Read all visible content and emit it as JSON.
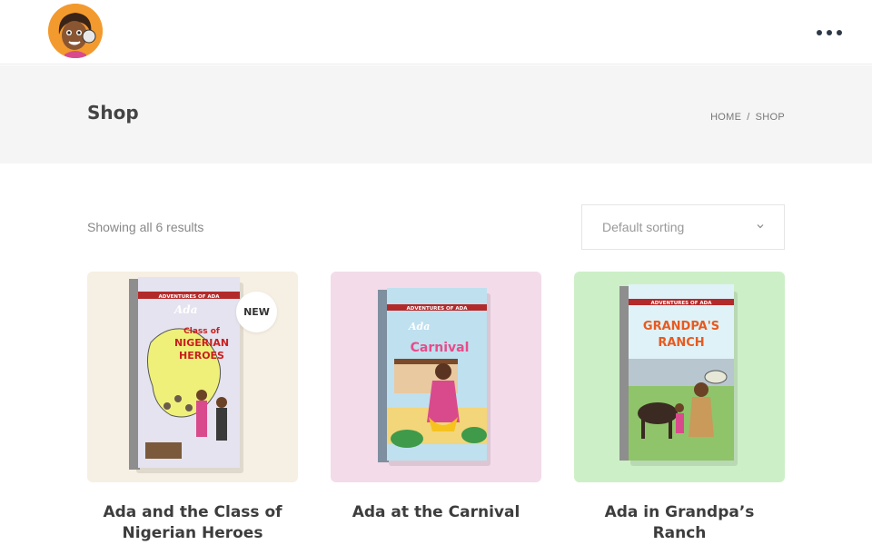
{
  "header": {
    "logo_icon": "avatar-logo-icon",
    "menu_icon": "more-dots-icon"
  },
  "title_band": {
    "title": "Shop",
    "breadcrumb": {
      "home": "HOME",
      "separator": "/",
      "current": "SHOP"
    }
  },
  "toolbar": {
    "results_text": "Showing all 6 results",
    "sort_selected": "Default sorting"
  },
  "colors": {
    "card1_bg": "#f6efe3",
    "card2_bg": "#f3dbe9",
    "card3_bg": "#cdefc7",
    "heading": "#3d3d3d",
    "band_bg": "#f5f5f5"
  },
  "products": [
    {
      "title": "Ada and the Class of Nigerian Heroes",
      "badge": "NEW",
      "cover_series": "ADVENTURES OF ADA",
      "cover_title": "Class of Nigerian Heroes"
    },
    {
      "title": "Ada at the Carnival",
      "badge": "",
      "cover_series": "ADVENTURES OF ADA",
      "cover_title": "Carnival"
    },
    {
      "title": "Ada in Grandpa’s Ranch",
      "badge": "",
      "cover_series": "ADVENTURES OF ADA",
      "cover_title": "GRANDPA'S RANCH"
    }
  ]
}
